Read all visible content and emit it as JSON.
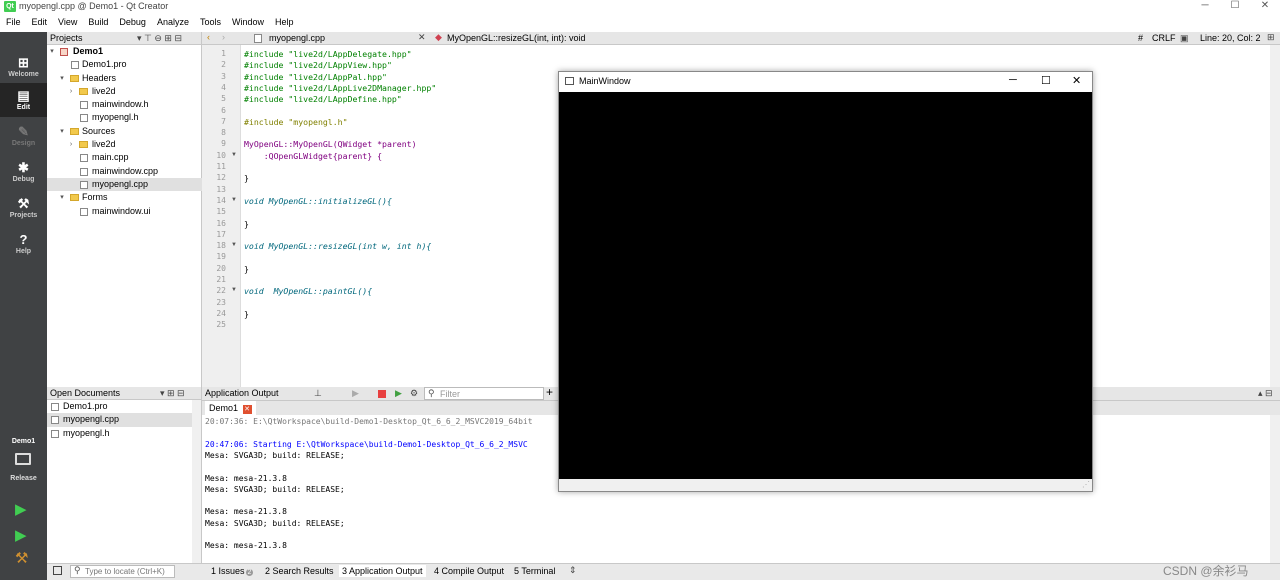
{
  "window": {
    "title": "myopengl.cpp @ Demo1 - Qt Creator",
    "qt_icon": "Qt"
  },
  "menu": [
    "File",
    "Edit",
    "View",
    "Build",
    "Debug",
    "Analyze",
    "Tools",
    "Window",
    "Help"
  ],
  "modes": [
    {
      "label": "Welcome",
      "icon": "grid-icon"
    },
    {
      "label": "Edit",
      "icon": "edit-icon"
    },
    {
      "label": "Design",
      "icon": "design-icon"
    },
    {
      "label": "Debug",
      "icon": "bug-icon"
    },
    {
      "label": "Projects",
      "icon": "wrench-icon"
    },
    {
      "label": "Help",
      "icon": "help-icon"
    }
  ],
  "kit": {
    "project": "Demo1",
    "config": "Release"
  },
  "projects_panel": {
    "title": "Projects",
    "tree": [
      {
        "label": "Demo1",
        "type": "project",
        "bold": true
      },
      {
        "label": "Demo1.pro",
        "type": "file"
      },
      {
        "label": "Headers",
        "type": "folder"
      },
      {
        "label": "live2d",
        "type": "folder"
      },
      {
        "label": "mainwindow.h",
        "type": "file"
      },
      {
        "label": "myopengl.h",
        "type": "file"
      },
      {
        "label": "Sources",
        "type": "folder"
      },
      {
        "label": "live2d",
        "type": "folder"
      },
      {
        "label": "main.cpp",
        "type": "file"
      },
      {
        "label": "mainwindow.cpp",
        "type": "file"
      },
      {
        "label": "myopengl.cpp",
        "type": "file",
        "selected": true
      },
      {
        "label": "Forms",
        "type": "folder"
      },
      {
        "label": "mainwindow.ui",
        "type": "file"
      }
    ]
  },
  "editor": {
    "file": "myopengl.cpp",
    "symbol": "MyOpenGL::resizeGL(int, int): void",
    "hash": "#",
    "line_ending": "CRLF",
    "position": "Line: 20, Col: 2",
    "lines": [
      "#include \"live2d/LAppDelegate.hpp\"",
      "#include \"live2d/LAppView.hpp\"",
      "#include \"live2d/LAppPal.hpp\"",
      "#include \"live2d/LAppLive2DManager.hpp\"",
      "#include \"live2d/LAppDefine.hpp\"",
      "",
      "#include \"myopengl.h\"",
      "",
      "MyOpenGL::MyOpenGL(QWidget *parent)",
      "    :QOpenGLWidget{parent} {",
      "",
      "}",
      "",
      "void MyOpenGL::initializeGL(){",
      "",
      "}",
      "",
      "void MyOpenGL::resizeGL(int w, int h){",
      "",
      "}",
      "",
      "void  MyOpenGL::paintGL(){",
      "",
      "}",
      ""
    ]
  },
  "open_documents": {
    "title": "Open Documents",
    "items": [
      "Demo1.pro",
      "myopengl.cpp",
      "myopengl.h"
    ]
  },
  "app_output": {
    "title": "Application Output",
    "filter_placeholder": "Filter",
    "tab": "Demo1",
    "lines": [
      "20:07:36: E:\\QtWorkspace\\build-Demo1-Desktop_Qt_6_6_2_MSVC2019_64bit",
      "",
      "20:47:06: Starting E:\\QtWorkspace\\build-Demo1-Desktop_Qt_6_6_2_MSVC",
      "Mesa: SVGA3D; build: RELEASE;",
      "",
      "Mesa: mesa-21.3.8",
      "Mesa: SVGA3D; build: RELEASE;",
      "",
      "Mesa: mesa-21.3.8",
      "Mesa: SVGA3D; build: RELEASE;",
      "",
      "Mesa: mesa-21.3.8"
    ]
  },
  "statusbar": {
    "locate_placeholder": "Type to locate (Ctrl+K)",
    "tabs": [
      {
        "label": "1  Issues",
        "badge": "2"
      },
      {
        "label": "2  Search Results"
      },
      {
        "label": "3  Application Output"
      },
      {
        "label": "4  Compile Output"
      },
      {
        "label": "5  Terminal"
      }
    ],
    "watermark": "CSDN @余衫马"
  },
  "mainwindow": {
    "title": "MainWindow"
  },
  "colors": {
    "keyword": "#808000",
    "string": "#008000",
    "class": "#800080",
    "func": "#00677c",
    "timestamp": "#0000ff",
    "accent": "#41cd52"
  }
}
